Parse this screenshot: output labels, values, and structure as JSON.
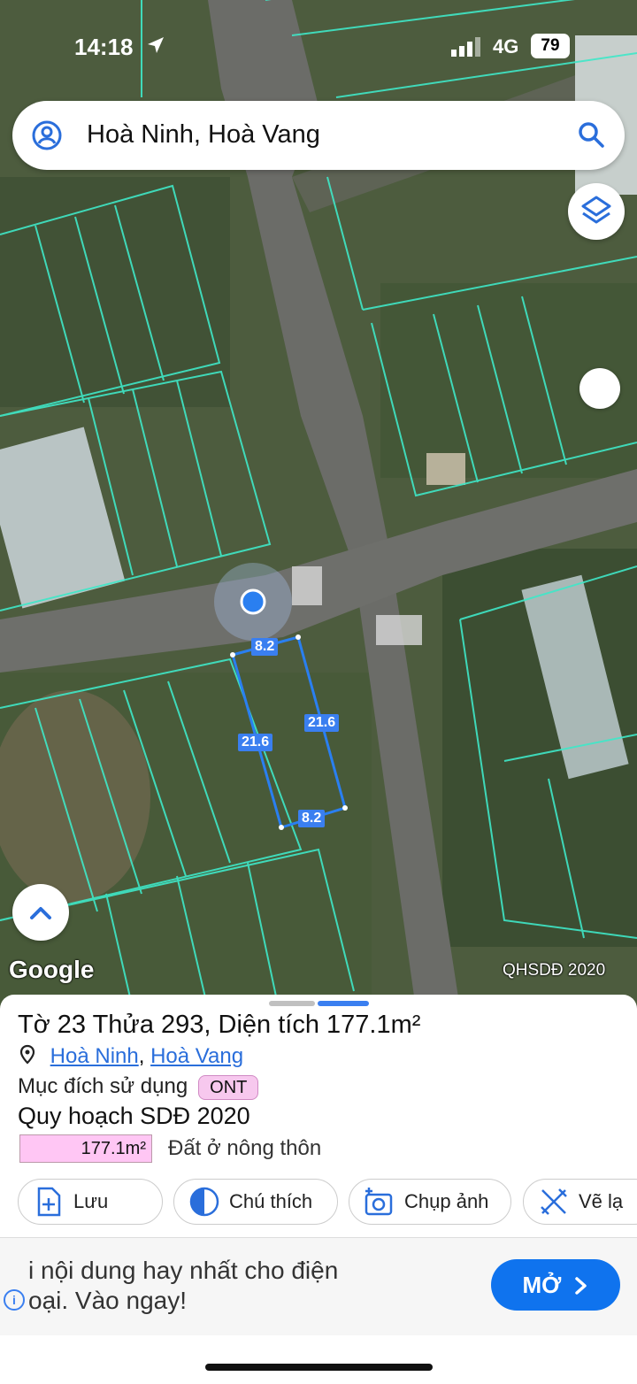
{
  "status_bar": {
    "time": "14:18",
    "network": "4G",
    "battery": "79"
  },
  "search": {
    "query": "Hoà Ninh, Hoà Vang"
  },
  "map": {
    "dimensions": {
      "top": "8.2",
      "right": "21.6",
      "left": "21.6",
      "bottom": "8.2"
    },
    "google_label": "Google",
    "layer_label": "QHSDĐ 2020",
    "parcel_color": "#2a7ff0",
    "grid_color": "#3fe8c8"
  },
  "parcel": {
    "title": "Tờ 23 Thửa 293, Diện tích 177.1m²",
    "ward": "Hoà Ninh",
    "separator": ",",
    "district": "Hoà Vang",
    "purpose_label": "Mục đích sử dụng",
    "purpose_code": "ONT",
    "plan_title": "Quy hoạch SDĐ 2020",
    "area_value": "177.1m²",
    "area_desc": "Đất ở nông thôn"
  },
  "actions": [
    {
      "label": "Lưu",
      "icon": "add-document-icon"
    },
    {
      "label": "Chú thích",
      "icon": "half-circle-icon"
    },
    {
      "label": "Chụp ảnh",
      "icon": "camera-plus-icon"
    },
    {
      "label": "Vẽ lạ",
      "icon": "draw-tools-icon"
    }
  ],
  "ad": {
    "line1": "i nội dung hay nhất cho điện",
    "line2": "oại. Vào ngay!",
    "button": "MỞ"
  }
}
